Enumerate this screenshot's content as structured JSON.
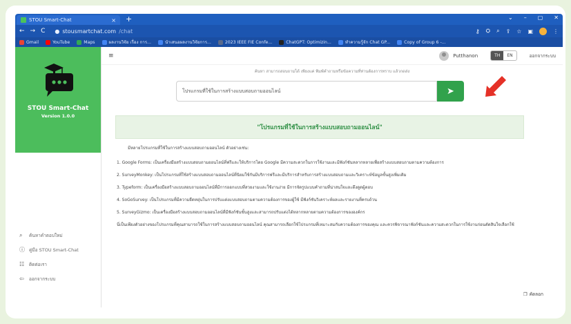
{
  "browser": {
    "tab_title": "STOU Smart-Chat",
    "tab_close": "×",
    "new_tab": "+",
    "window_controls": [
      "⌄",
      "–",
      "▢",
      "✕"
    ],
    "nav": {
      "back": "←",
      "forward": "→",
      "reload": "C"
    },
    "url_host": "stousmartchat.com",
    "url_path": "/chat",
    "bookmarks": [
      {
        "label": "Gmail",
        "color": "#ea4335"
      },
      {
        "label": "YouTube",
        "color": "#ff0000"
      },
      {
        "label": "Maps",
        "color": "#34a853"
      },
      {
        "label": "ผลงานวิจัย เรื่อง การ...",
        "color": "#4285f4"
      },
      {
        "label": "นำเสนอผลงานวิจัยการ...",
        "color": "#4285f4"
      },
      {
        "label": "2023 IEEE FIE Confe...",
        "color": "#5a6b8c"
      },
      {
        "label": "ChatGPT: Optimizin...",
        "color": "#222222"
      },
      {
        "label": "ทำความรู้จัก Chat GP...",
        "color": "#4285f4"
      },
      {
        "label": "Copy of Group 6 -...",
        "color": "#4285f4"
      }
    ]
  },
  "sidebar": {
    "title": "STOU Smart-Chat",
    "version": "Version 1.0.0",
    "items": [
      {
        "icon": "search-icon",
        "glyph": "⌕",
        "label": "ค้นหาคำตอบใหม่"
      },
      {
        "icon": "info-icon",
        "glyph": "ⓘ",
        "label": "คู่มือ STOU Smart-Chat"
      },
      {
        "icon": "contact-icon",
        "glyph": "☷",
        "label": "ติดต่อเรา"
      },
      {
        "icon": "logout-icon",
        "glyph": "⇦",
        "label": "ออกจากระบบ"
      }
    ]
  },
  "topbar": {
    "menu_glyph": "≡",
    "user_name": "Putthanon",
    "lang_th": "TH",
    "lang_en": "EN",
    "logout": "ออกจากระบบ"
  },
  "chat": {
    "notice": "ค้นหา สามารถสอบถามได้ เพียงแค่ พิมพ์คำถามหรือข้อความที่ท่านต้องการทราบ แล้วกดส่ง",
    "question": "โปรแกรมที่ใช้ในการสร้างแบบสอบถามออนไลน์",
    "send_glyph": "➤",
    "result_title": "\"โปรแกรมที่ใช้ในการสร้างแบบสอบถามออนไลน์\"",
    "answer_intro": "มีหลายโปรแกรมที่ใช้ในการสร้างแบบสอบถามออนไลน์ ตัวอย่างเช่น:",
    "answer_items": [
      "1. Google Forms: เป็นเครื่องมือสร้างแบบสอบถามออนไลน์ที่ฟรีและให้บริการโดย Google มีความสะดวกในการใช้งานและมีฟังก์ชันหลากหลายเพื่อสร้างแบบสอบถามตามความต้องการ",
      "2. SurveyMonkey: เป็นโปรแกรมที่ใช้สร้างแบบสอบถามออนไลน์ที่นิยมใช้กันมีบริการฟรีและมีบริการสำหรับการสร้างแบบสอบถามและวิเคราะห์ข้อมูลขั้นสูงเพิ่มเติม",
      "3. Typeform: เป็นเครื่องมือสร้างแบบสอบถามออนไลน์ที่มีการออกแบบที่สวยงามและใช้งานง่าย มีการจัดรูปแบบคำถามที่น่าสนใจและดึงดูดผู้ตอบ",
      "4. SoGoSurvey: เป็นโปรแกรมที่มีความยืดหยุ่นในการปรับแต่งแบบสอบถามตามความต้องการของผู้ใช้ มีฟังก์ชันวิเคราะห์ผลและรายงานที่ครบถ้วน",
      "5. SurveyGizmo: เป็นเครื่องมือสร้างแบบสอบถามออนไลน์ที่มีฟังก์ชันขั้นสูงและสามารถปรับแต่งได้หลากหลายตามความต้องการขององค์กร",
      "นี่เป็นเพียงตัวอย่างของโปรแกรมที่คุณสามารถใช้ในการสร้างแบบสอบถามออนไลน์ คุณสามารถเลือกใช้โปรแกรมที่เหมาะสมกับความต้องการของคุณ และควรพิจารณาฟังก์ชันและความสะดวกในการใช้งานก่อนตัดสินใจเลือกใช้"
    ],
    "copy_label": "คัดลอก",
    "copy_glyph": "❐"
  },
  "colors": {
    "brand_green": "#4cbd5c",
    "send_green": "#31a24c",
    "result_green": "#2e8f44",
    "browser_blue": "#1f5fbf",
    "arrow_red": "#e53127"
  }
}
